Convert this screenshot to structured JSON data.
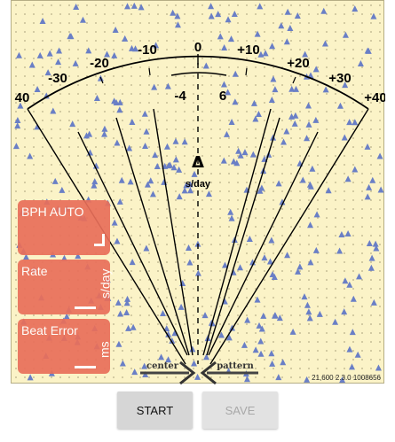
{
  "scale": {
    "outer_ticks": [
      "40",
      "-30",
      "-20",
      "-10",
      "0",
      "+10",
      "+20",
      "+30",
      "+40"
    ],
    "inner_left": "-4",
    "inner_right": "6"
  },
  "center_symbol": "Δ",
  "center_unit": "s/day",
  "panels": {
    "bph": {
      "label": "BPH AUTO",
      "unit": ""
    },
    "rate": {
      "label": "Rate",
      "unit": "s/day"
    },
    "beat_error": {
      "label": "Beat Error",
      "unit": "ms"
    }
  },
  "bottom": {
    "center_label": "center",
    "pattern_label": "pattern",
    "version": "21,600 2.3.0 1008656"
  },
  "buttons": {
    "start": "START",
    "save": "SAVE"
  },
  "colors": {
    "background": "#fbf3c7",
    "panel": "#e96f5a",
    "marker": "#6a7fc6"
  }
}
